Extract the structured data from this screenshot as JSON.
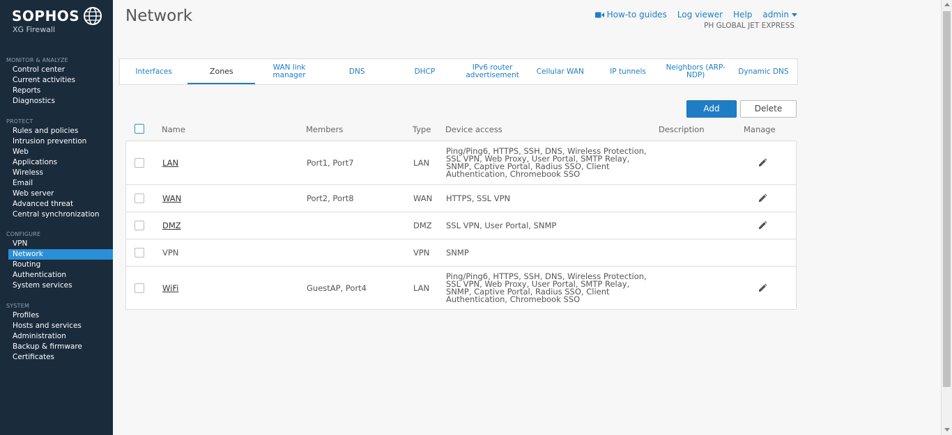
{
  "brand": {
    "name": "SOPHOS",
    "product": "XG Firewall"
  },
  "sidebar": {
    "sections": [
      {
        "title": "MONITOR & ANALYZE",
        "items": [
          "Control center",
          "Current activities",
          "Reports",
          "Diagnostics"
        ]
      },
      {
        "title": "PROTECT",
        "items": [
          "Rules and policies",
          "Intrusion prevention",
          "Web",
          "Applications",
          "Wireless",
          "Email",
          "Web server",
          "Advanced threat",
          "Central synchronization"
        ]
      },
      {
        "title": "CONFIGURE",
        "items": [
          "VPN",
          "Network",
          "Routing",
          "Authentication",
          "System services"
        ]
      },
      {
        "title": "SYSTEM",
        "items": [
          "Profiles",
          "Hosts and services",
          "Administration",
          "Backup & firmware",
          "Certificates"
        ]
      }
    ],
    "active_item": "Network"
  },
  "header": {
    "title": "Network",
    "links": {
      "howto": "How-to guides",
      "log_viewer": "Log viewer",
      "help": "Help",
      "user": "admin"
    },
    "org": "PH GLOBAL JET EXPRESS"
  },
  "tabs": {
    "items": [
      "Interfaces",
      "Zones",
      "WAN link manager",
      "DNS",
      "DHCP",
      "IPv6 router advertisement",
      "Cellular WAN",
      "IP tunnels",
      "Neighbors (ARP-NDP)",
      "Dynamic DNS"
    ],
    "active": "Zones"
  },
  "actions": {
    "add": "Add",
    "delete": "Delete"
  },
  "table": {
    "headers": {
      "name": "Name",
      "members": "Members",
      "type": "Type",
      "device_access": "Device access",
      "description": "Description",
      "manage": "Manage"
    },
    "rows": [
      {
        "name": "LAN",
        "link": true,
        "members": "Port1, Port7",
        "type": "LAN",
        "device_access": "Ping/Ping6, HTTPS, SSH, DNS, Wireless Protection, SSL VPN, Web Proxy, User Portal, SMTP Relay, SNMP, Captive Portal, Radius SSO, Client Authentication, Chromebook SSO",
        "description": "",
        "editable": true
      },
      {
        "name": "WAN",
        "link": true,
        "members": "Port2, Port8",
        "type": "WAN",
        "device_access": "HTTPS, SSL VPN",
        "description": "",
        "editable": true
      },
      {
        "name": "DMZ",
        "link": true,
        "members": "",
        "type": "DMZ",
        "device_access": "SSL VPN, User Portal, SNMP",
        "description": "",
        "editable": true
      },
      {
        "name": "VPN",
        "link": false,
        "members": "",
        "type": "VPN",
        "device_access": "SNMP",
        "description": "",
        "editable": false
      },
      {
        "name": "WiFi",
        "link": true,
        "members": "GuestAP, Port4",
        "type": "LAN",
        "device_access": "Ping/Ping6, HTTPS, SSH, DNS, Wireless Protection, SSL VPN, Web Proxy, User Portal, SMTP Relay, SNMP, Captive Portal, Radius SSO, Client Authentication, Chromebook SSO",
        "description": "",
        "editable": true
      }
    ]
  },
  "colors": {
    "sidebar_bg": "#1a2b3c",
    "accent": "#1f7dc6",
    "active_nav": "#2b8fd6"
  }
}
